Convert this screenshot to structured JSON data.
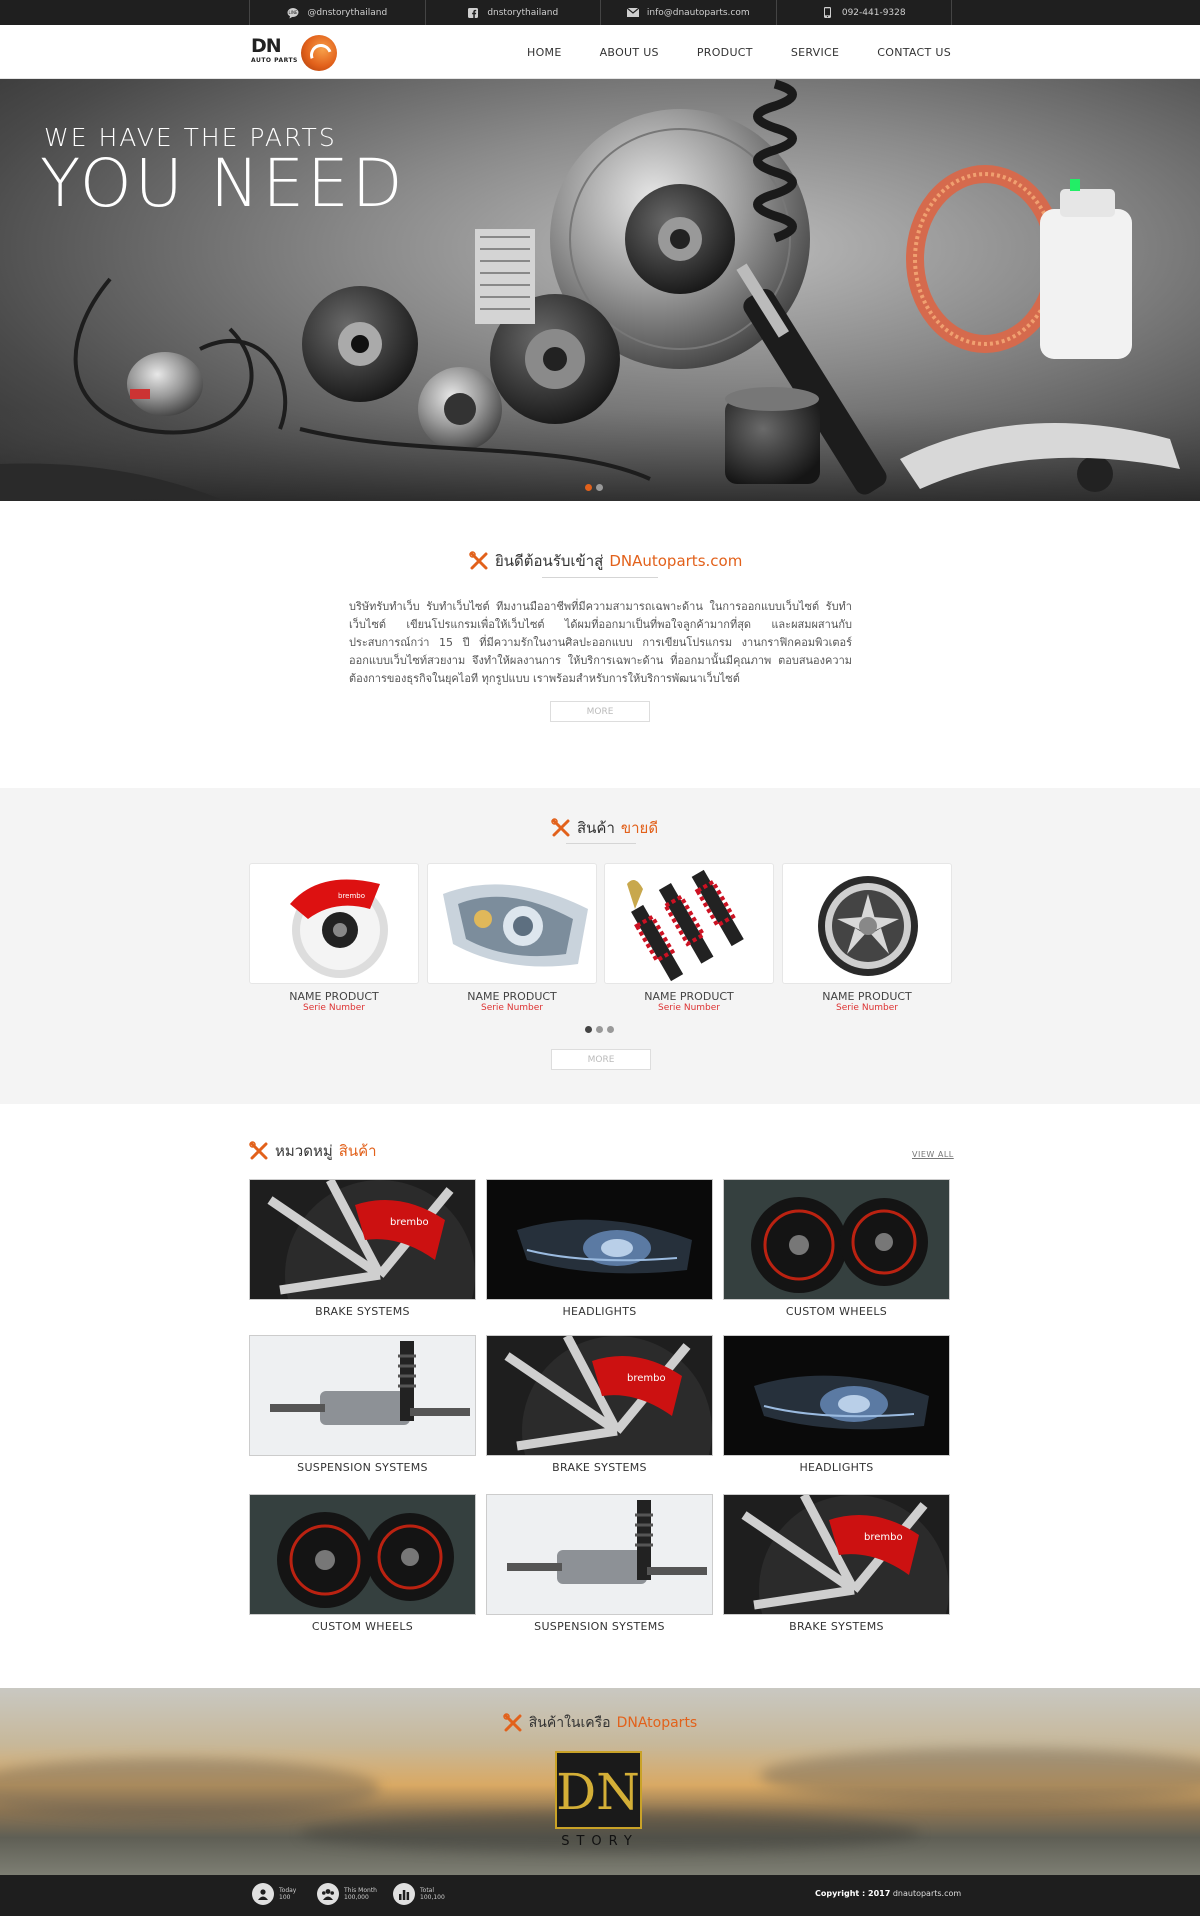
{
  "topbar": {
    "line": "@dnstorythailand",
    "facebook": "dnstorythailand",
    "email": "info@dnautoparts.com",
    "phone": "092-441-9328"
  },
  "logo": {
    "mark": "DN",
    "sub": "AUTO PARTS"
  },
  "nav": [
    "HOME",
    "ABOUT US",
    "PRODUCT",
    "SERVICE",
    "CONTACT US"
  ],
  "hero": {
    "line1": "WE HAVE THE PARTS",
    "line2": "YOU NEED",
    "slides": 2,
    "active_slide": 0
  },
  "welcome": {
    "title_prefix": "ยินดีต้อนรับเข้าสู่ ",
    "title_accent": "DNAutoparts.com",
    "body": "บริษัทรับทำเว็บ รับทำเว็บไซต์ ทีมงานมืออาชีพที่มีความสามารถเฉพาะด้าน ในการออกแบบเว็บไซต์ รับทำเว็บไซต์ เขียนโปรแกรมเพื่อให้เว็บไซต์ ได้ผมที่ออกมาเป็นที่พอใจลูกค้ามากที่สุด และผสมผสานกับประสบการณ์กว่า 15 ปี ที่มีความรักในงานศิลปะออกแบบ การเขียนโปรแกรม งานกราฟิกคอมพิวเตอร์ ออกแบบเว็บไซท์สวยงาม จึงทำให้ผลงานการ ให้บริการเฉพาะด้าน ที่ออกมานั้นมีคุณภาพ ตอบสนองความต้องการของธุรกิจในยุคไอที ทุกรูปแบบ เราพร้อมสำหรับการให้บริการพัฒนาเว็บไซต์",
    "more": "MORE"
  },
  "bestsellers": {
    "title_prefix": "สินค้า",
    "title_accent": "ขายดี",
    "items": [
      {
        "name": "NAME PRODUCT",
        "serie": "Serie Number",
        "image": "brake-caliper"
      },
      {
        "name": "NAME PRODUCT",
        "serie": "Serie Number",
        "image": "headlight"
      },
      {
        "name": "NAME PRODUCT",
        "serie": "Serie Number",
        "image": "shock-absorbers"
      },
      {
        "name": "NAME PRODUCT",
        "serie": "Serie Number",
        "image": "alloy-wheel"
      }
    ],
    "pages": 3,
    "active_page": 0,
    "more": "MORE"
  },
  "categories": {
    "title_prefix": "หมวดหมู่",
    "title_accent": "สินค้า",
    "view_all": "VIEW ALL",
    "items": [
      {
        "label": "BRAKE SYSTEMS",
        "image": "brake"
      },
      {
        "label": "HEADLIGHTS",
        "image": "headlight"
      },
      {
        "label": "CUSTOM WHEELS",
        "image": "wheels"
      },
      {
        "label": "SUSPENSION SYSTEMS",
        "image": "suspension"
      },
      {
        "label": "BRAKE SYSTEMS",
        "image": "brake"
      },
      {
        "label": "HEADLIGHTS",
        "image": "headlight"
      },
      {
        "label": "CUSTOM WHEELS",
        "image": "wheels"
      },
      {
        "label": "SUSPENSION SYSTEMS",
        "image": "suspension"
      },
      {
        "label": "BRAKE SYSTEMS",
        "image": "brake"
      }
    ]
  },
  "network": {
    "title_prefix": "สินค้าในเครือ",
    "title_accent": "DNAtoparts",
    "brand_mark": "DN",
    "brand_word": "STORY"
  },
  "footer": {
    "stats": [
      {
        "label": "Today",
        "value": "100",
        "icon": "person-icon"
      },
      {
        "label": "This Month",
        "value": "100,000",
        "icon": "group-icon"
      },
      {
        "label": "Total",
        "value": "100,100",
        "icon": "bar-chart-icon"
      }
    ],
    "copyright_label": "Copyright : 2017",
    "copyright_site": "dnautoparts.com"
  },
  "colors": {
    "accent": "#e2611b",
    "dark": "#1f1f1f",
    "serie": "#dd3333"
  }
}
